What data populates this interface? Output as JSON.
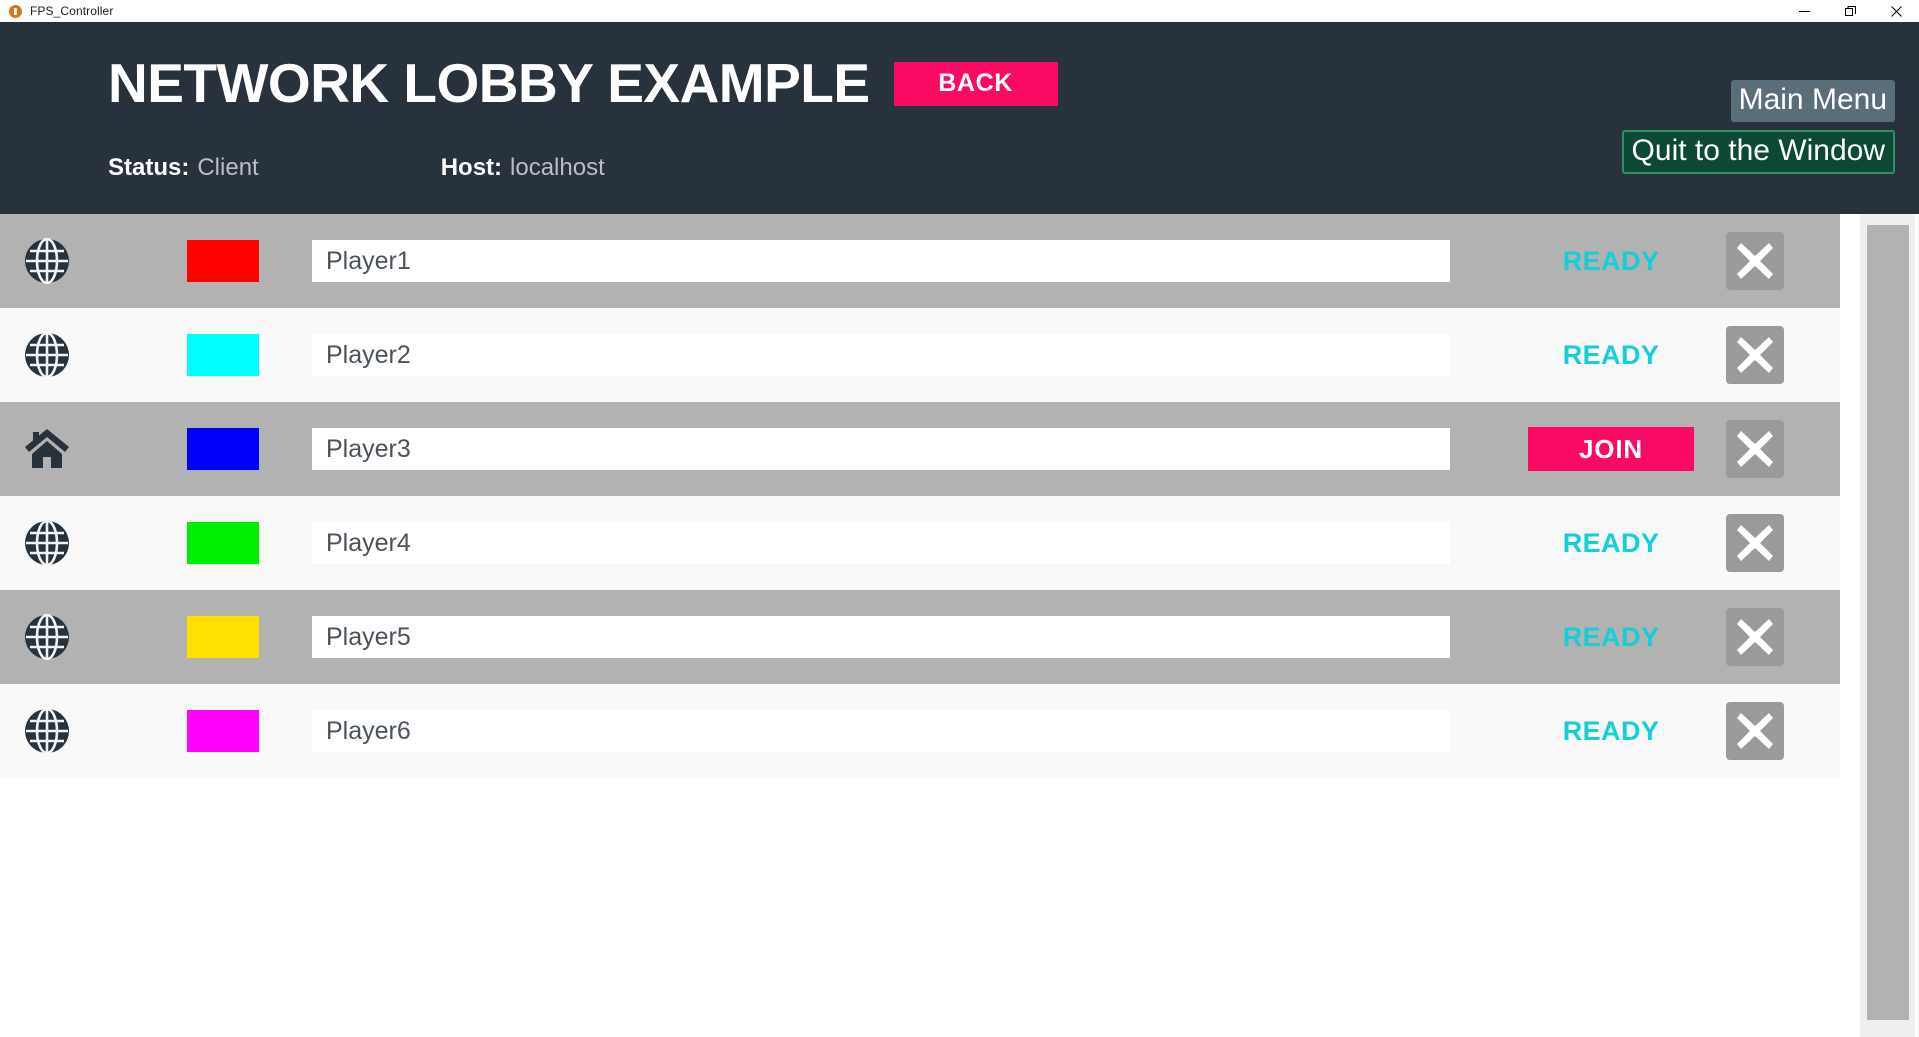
{
  "window": {
    "app_title": "FPS_Controller",
    "icon": "unity-app-icon",
    "controls": [
      {
        "name": "minimize",
        "glyph": "minimize-icon"
      },
      {
        "name": "maximize",
        "glyph": "restore-icon"
      },
      {
        "name": "close",
        "glyph": "close-icon"
      }
    ]
  },
  "header": {
    "title": "NETWORK LOBBY EXAMPLE",
    "back_label": "BACK",
    "status_label": "Status:",
    "status_value": "Client",
    "host_label": "Host:",
    "host_value": "localhost",
    "main_menu_label": "Main Menu",
    "quit_label": "Quit to the Window",
    "background_color": "#28323c",
    "accent_color": "#fa0a62",
    "main_menu_color": "#5a6e7a",
    "quit_color": "#0d4832",
    "quit_border_color": "#2f8f68"
  },
  "lobby": {
    "ready_color": "#14cfd6",
    "join_color": "#fa0a62",
    "row_alt_color": "#b2b2b2",
    "row_plain_color": "#f9f9f9",
    "kick_label": "close-icon",
    "players": [
      {
        "icon": "globe-icon",
        "color": "#ff0000",
        "name": "Player1",
        "status": "READY",
        "action": "ready",
        "row_style": "alt"
      },
      {
        "icon": "globe-icon",
        "color": "#00ffff",
        "name": "Player2",
        "status": "READY",
        "action": "ready",
        "row_style": "plain"
      },
      {
        "icon": "home-icon",
        "color": "#0000ff",
        "name": "Player3",
        "status": "JOIN",
        "action": "join",
        "row_style": "alt"
      },
      {
        "icon": "globe-icon",
        "color": "#00ee00",
        "name": "Player4",
        "status": "READY",
        "action": "ready",
        "row_style": "plain"
      },
      {
        "icon": "globe-icon",
        "color": "#ffe000",
        "name": "Player5",
        "status": "READY",
        "action": "ready",
        "row_style": "alt"
      },
      {
        "icon": "globe-icon",
        "color": "#ff00ff",
        "name": "Player6",
        "status": "READY",
        "action": "ready",
        "row_style": "plain"
      }
    ]
  },
  "scrollbar": {
    "orientation": "vertical",
    "track_color": "#efefef",
    "thumb_color": "#b2b2b2"
  }
}
